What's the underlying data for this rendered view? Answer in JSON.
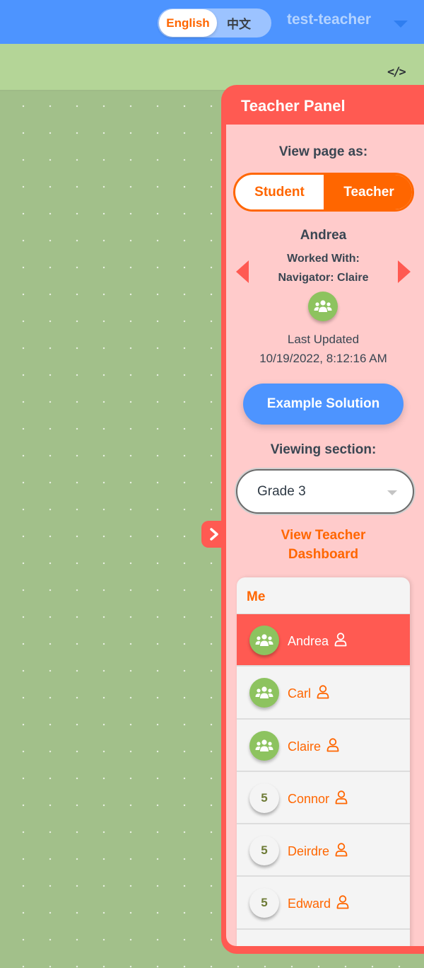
{
  "topbar": {
    "languages": [
      {
        "label": "English",
        "active": true
      },
      {
        "label": "中文",
        "active": false
      }
    ],
    "user_name": "test-teacher",
    "user_menu_icon": "caret-down-icon"
  },
  "toolbar": {
    "code_icon_label": "</>"
  },
  "panel": {
    "title": "Teacher Panel",
    "view_as_label": "View page as:",
    "roles": [
      {
        "label": "Student",
        "active": false
      },
      {
        "label": "Teacher",
        "active": true
      }
    ],
    "selected_student": {
      "name": "Andrea",
      "worked_with_label": "Worked With:",
      "worked_with_value": "Navigator: Claire",
      "last_updated_label": "Last Updated",
      "last_updated_value": "10/19/2022, 8:12:16 AM"
    },
    "example_solution_label": "Example Solution",
    "viewing_section_label": "Viewing section:",
    "section_value": "Grade 3",
    "dashboard_link_line1": "View Teacher",
    "dashboard_link_line2": "Dashboard",
    "list_header": "Me",
    "students": [
      {
        "name": "Andrea",
        "avatar": "group",
        "score": "",
        "selected": true
      },
      {
        "name": "Carl",
        "avatar": "group",
        "score": "",
        "selected": false
      },
      {
        "name": "Claire",
        "avatar": "group",
        "score": "",
        "selected": false
      },
      {
        "name": "Connor",
        "avatar": "score",
        "score": "5",
        "selected": false
      },
      {
        "name": "Deirdre",
        "avatar": "score",
        "score": "5",
        "selected": false
      },
      {
        "name": "Edward",
        "avatar": "score",
        "score": "5",
        "selected": false
      }
    ]
  },
  "colors": {
    "topbar_blue": "#4d94ff",
    "toolbar_green": "#b4d597",
    "canvas_green": "#a2c08a",
    "panel_red": "#ff5a52",
    "panel_pink": "#ffcbcb",
    "accent_orange": "#ff6600",
    "avatar_green": "#8dc35f"
  }
}
